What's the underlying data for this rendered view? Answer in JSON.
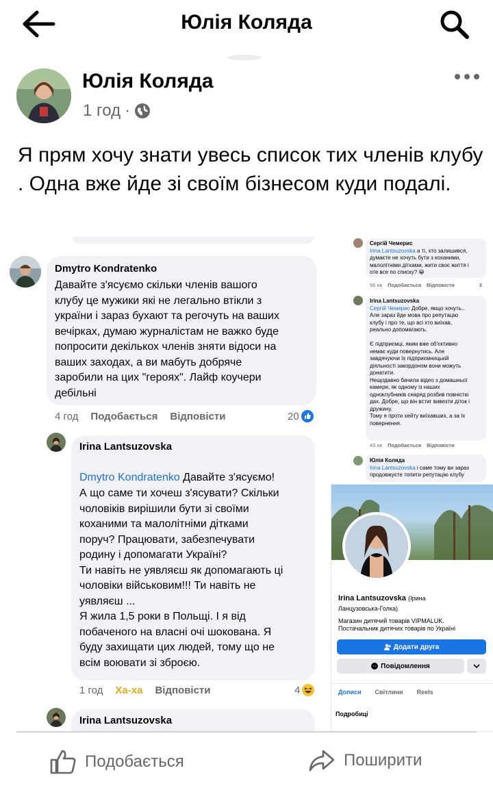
{
  "header": {
    "title": "Юлія Коляда"
  },
  "post": {
    "author": "Юлія Коляда",
    "time": "1 год",
    "dot": "·",
    "text": "Я прям хочу знати увесь список тих членів клубу . Одна вже йде зі своїм бізнесом куди подалі."
  },
  "comments": [
    {
      "name": "Dmytro Kondratenko",
      "text": "Давайте з'ясуємо скільки членів вашого\nклубу це мужики які не легально втікли з\nукраїни і зараз бухают та регочуть на ваших\nвечірках, думаю журналістам не важко буде\nпопросити декількох членів зняти відоси на\nваших заходах, а ви мабуть добряче\nзаробили на цих \"героях\". Лайф коучери\nдебільні",
      "time": "4 год",
      "like": "Подобається",
      "reply": "Відповісти",
      "count": "20"
    },
    {
      "name": "Irina Lantsuzovska",
      "mention": "Dmytro Kondratenko",
      "mention_tail": " Давайте з'ясуємо!",
      "text": "А що саме ти хочеш  з'ясувати? Скільки\nчоловіків вирішили бути зі своїми\nкоханими та малолітніми дітками\nпоруч? Працювати, забезпечувати\nродину і допомагати Україні?\nТи навіть не уявляєш як допомагають ці\nчоловіки військовим!!! Ти навіть не\nуявляєш ...\nЯ жила 1,5 роки в Польщі. І я від\nпобаченого на власні очі шокована. Я\nбуду захищати цих людей, тому що не\nвсім воювати зі зброєю.",
      "time": "1 год",
      "like": "Ха-ха",
      "reply": "Відповісти",
      "count": "4"
    },
    {
      "name": "Irina Lantsuzovska"
    }
  ],
  "mini_comments": [
    {
      "name": "Сергій Чемерис",
      "mention": "Irina Lantsuzovska",
      "text": " а ті, хто залишився,\nдумаєте не хочуть бути з коханими,\nмалолітніми дітками, жити своє життя і\nоте все по списку? 😀",
      "time": "56 хв",
      "like": "Подобається",
      "reply": "Відповісти",
      "count": "3"
    },
    {
      "name": "Irina Lantsuzovska",
      "mention": "Сергій Чемерис",
      "text": " Добре, якщо хочуть..\nАле зараз йде мова про репутацію\nклубу і про те, що всі хто виїхав,\nреально допомагають.\n\nЄ підприємці, яким вже об'єктивно\nнемає куди повернутись. Але\nзавдячуючи їх підприємницькій\nдіяльності закордоном вони можуть\nдонатити.\nНещодавно бачила відео з домашньої\nкамери, як одному із наших\nодноклубників снаряд розбив повністю\nдах. Добре, що він встиг вивезти діток і\nдружину.\nТому я проти хейту виїхавших, а за їх\nповернення.",
      "time": "43 хв",
      "like": "Подобається",
      "reply": "Відповісти"
    },
    {
      "name": "Юлія Коляда",
      "mention": "Irina Lantsuzovska",
      "text": " і саме тому ви зараз\nпродовжуєте топити репутацію клубу"
    }
  ],
  "profile": {
    "name": "Irina Lantsuzovska",
    "name_alt": "(Ірина",
    "name_alt2": "Ланцузовська-Голка)",
    "bio1": "Магазин дитячий товарів VIPMALUK.",
    "bio2": "Постачальник дитячих товарів по Україні",
    "add_friend": "Додати друга",
    "message": "Повідомлення",
    "tabs": [
      "Дописи",
      "Світлини",
      "Reels"
    ],
    "details": "Подробиці"
  },
  "footer": {
    "like": "Подобається",
    "share": "Поширити"
  },
  "colors": {
    "link": "#216fdb",
    "accent": "#1b74e4",
    "haha": "#e6a817",
    "muted": "#65676b"
  }
}
